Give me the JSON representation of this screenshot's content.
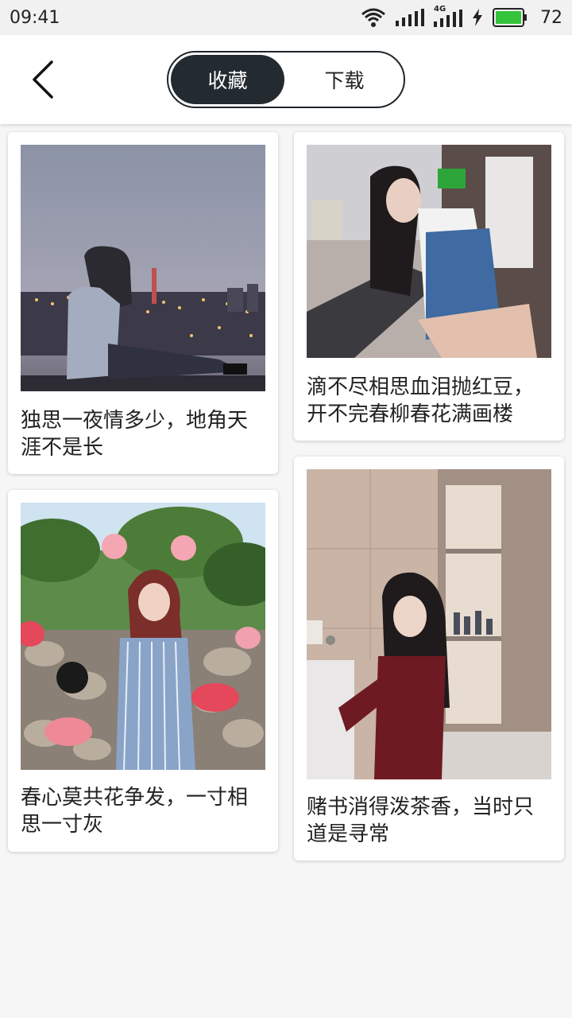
{
  "status_bar": {
    "time": "09:41",
    "network_label": "4G",
    "battery_level": "72",
    "icons": [
      "wifi-icon",
      "signal-icon",
      "signal-4g-icon",
      "charging-icon",
      "battery-icon"
    ],
    "battery_color": "#35c33b"
  },
  "header": {
    "back_icon": "chevron-left-icon",
    "tabs": [
      {
        "label": "收藏",
        "active": true
      },
      {
        "label": "下载",
        "active": false
      }
    ],
    "active_tab_color": "#232a30"
  },
  "cards": [
    {
      "caption": "独思一夜情多少，地角天涯不是长"
    },
    {
      "caption": "滴不尽相思血泪抛红豆，开不完春柳春花满画楼"
    },
    {
      "caption": "春心莫共花争发，一寸相思一寸灰"
    },
    {
      "caption": "赌书消得泼茶香，当时只道是寻常"
    }
  ]
}
